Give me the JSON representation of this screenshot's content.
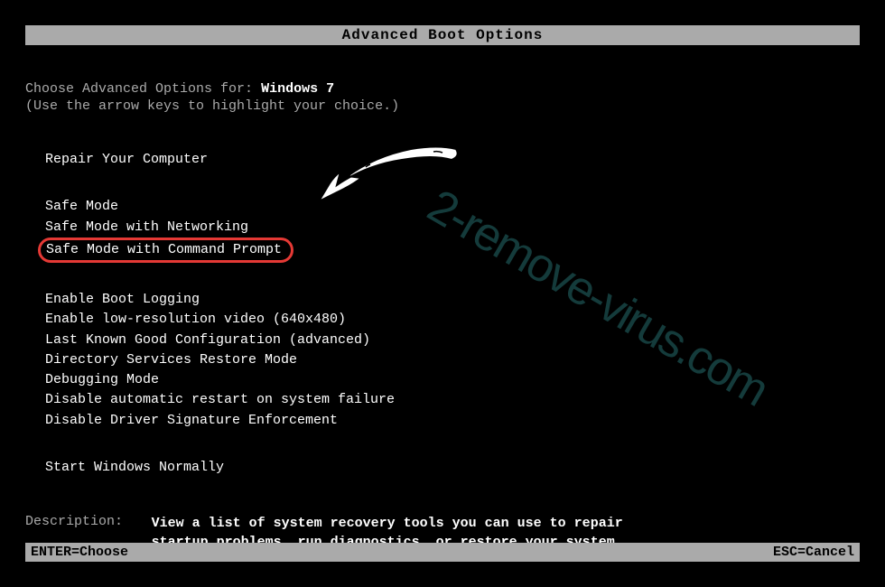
{
  "title": "Advanced Boot Options",
  "prompt": {
    "label": "Choose Advanced Options for:",
    "os": "Windows 7",
    "hint": "(Use the arrow keys to highlight your choice.)"
  },
  "options": {
    "group1": [
      "Repair Your Computer"
    ],
    "group2": [
      "Safe Mode",
      "Safe Mode with Networking",
      "Safe Mode with Command Prompt"
    ],
    "group3": [
      "Enable Boot Logging",
      "Enable low-resolution video (640x480)",
      "Last Known Good Configuration (advanced)",
      "Directory Services Restore Mode",
      "Debugging Mode",
      "Disable automatic restart on system failure",
      "Disable Driver Signature Enforcement"
    ],
    "group4": [
      "Start Windows Normally"
    ],
    "selected": "Safe Mode with Command Prompt"
  },
  "description": {
    "label": "Description:",
    "text": "View a list of system recovery tools you can use to repair startup problems, run diagnostics, or restore your system."
  },
  "footer": {
    "left": "ENTER=Choose",
    "right": "ESC=Cancel"
  },
  "watermark": "2-remove-virus.com"
}
